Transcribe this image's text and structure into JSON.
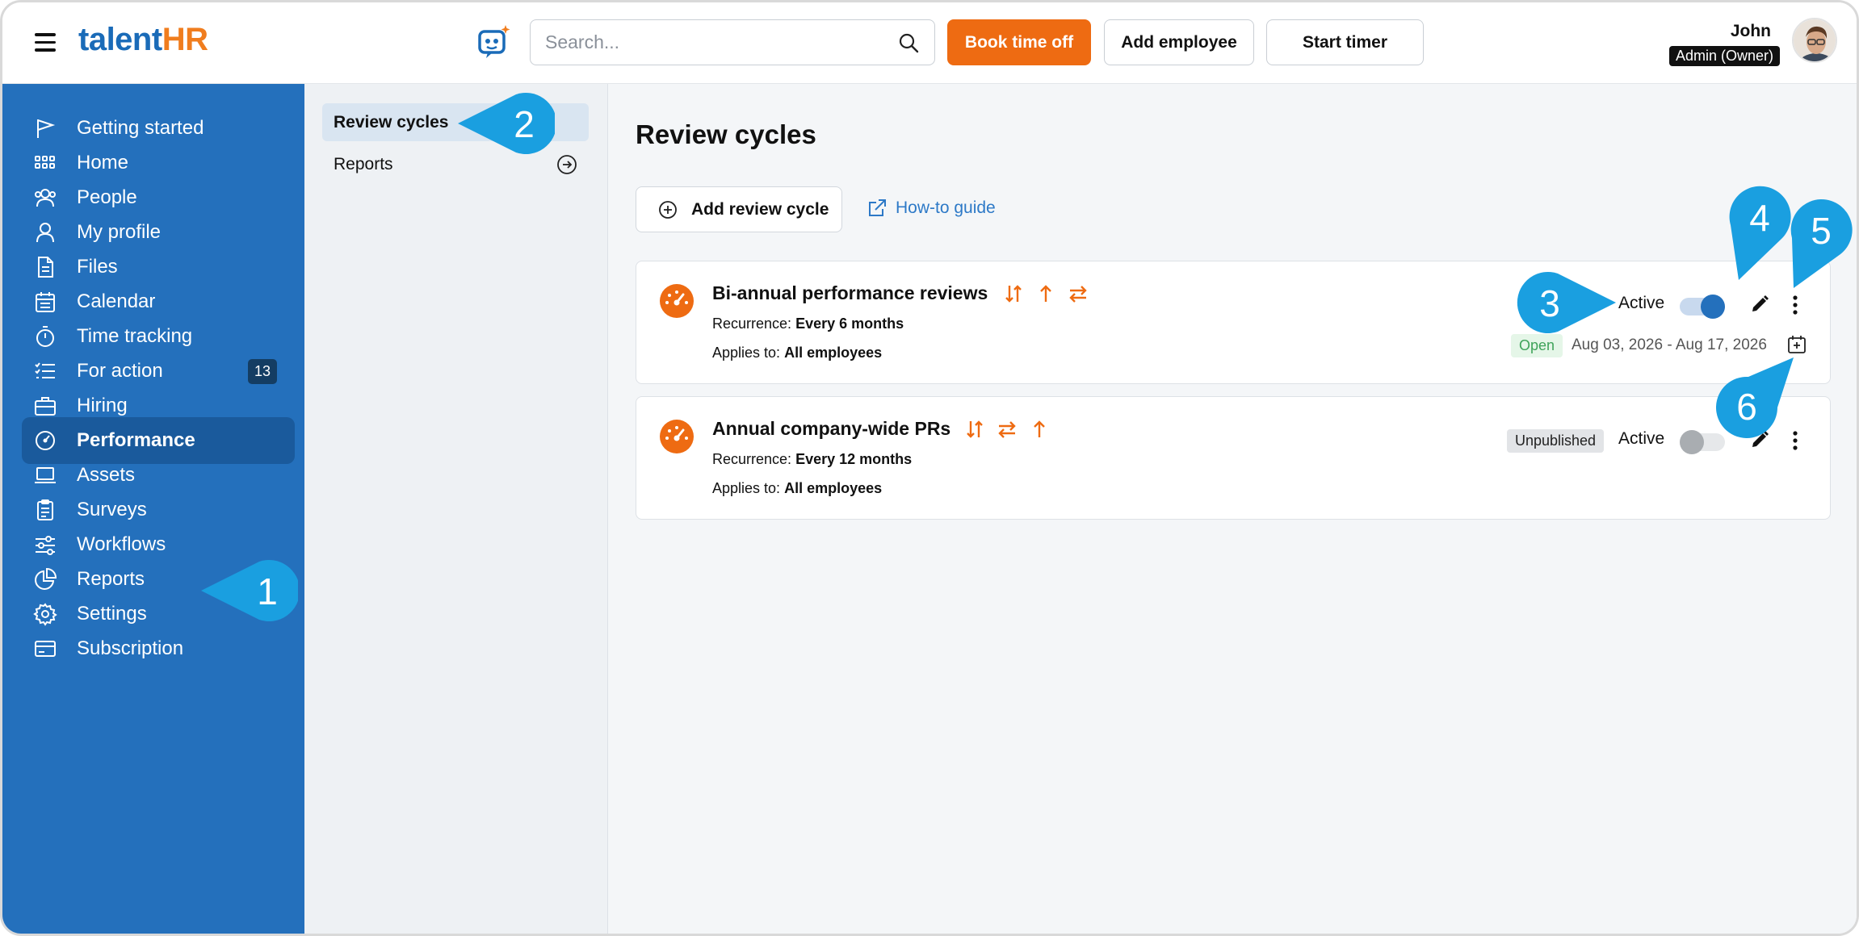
{
  "header": {
    "logo_talent": "talent",
    "logo_hr": "HR",
    "search_placeholder": "Search...",
    "book_time_off": "Book time off",
    "add_employee": "Add employee",
    "start_timer": "Start timer",
    "user_name": "John",
    "user_role": "Admin (Owner)"
  },
  "sidebar": {
    "items": [
      {
        "label": "Getting started",
        "icon": "flag-icon"
      },
      {
        "label": "Home",
        "icon": "grid-icon"
      },
      {
        "label": "People",
        "icon": "people-icon"
      },
      {
        "label": "My profile",
        "icon": "user-icon"
      },
      {
        "label": "Files",
        "icon": "file-icon"
      },
      {
        "label": "Calendar",
        "icon": "calendar-icon"
      },
      {
        "label": "Time tracking",
        "icon": "stopwatch-icon"
      },
      {
        "label": "For action",
        "icon": "checklist-icon",
        "count": "13"
      },
      {
        "label": "Hiring",
        "icon": "briefcase-icon"
      },
      {
        "label": "Performance",
        "icon": "gauge-icon",
        "active": true
      },
      {
        "label": "Assets",
        "icon": "laptop-icon"
      },
      {
        "label": "Surveys",
        "icon": "clipboard-icon"
      },
      {
        "label": "Workflows",
        "icon": "workflow-icon"
      },
      {
        "label": "Reports",
        "icon": "pie-chart-icon"
      },
      {
        "label": "Settings",
        "icon": "gear-icon"
      },
      {
        "label": "Subscription",
        "icon": "credit-card-icon"
      }
    ]
  },
  "subnav": {
    "review_cycles": "Review cycles",
    "reports": "Reports"
  },
  "main": {
    "title": "Review cycles",
    "add_review_cycle": "Add review cycle",
    "how_to_guide": "How-to guide",
    "cards": [
      {
        "title": "Bi-annual performance reviews",
        "recurrence_label": "Recurrence:",
        "recurrence": "Every 6 months",
        "applies_label": "Applies to:",
        "applies": "All employees",
        "active_label": "Active",
        "active": true,
        "status": "Open",
        "date_range": "Aug 03, 2026 - Aug 17, 2026"
      },
      {
        "title": "Annual company-wide PRs",
        "recurrence_label": "Recurrence:",
        "recurrence": "Every 12 months",
        "applies_label": "Applies to:",
        "applies": "All employees",
        "active_label": "Active",
        "active": false,
        "status": "Unpublished"
      }
    ]
  },
  "callouts": [
    "1",
    "2",
    "3",
    "4",
    "5",
    "6"
  ],
  "colors": {
    "sidebar": "#2470bc",
    "accent_orange": "#ee6b12",
    "callout": "#1a9fe0"
  }
}
